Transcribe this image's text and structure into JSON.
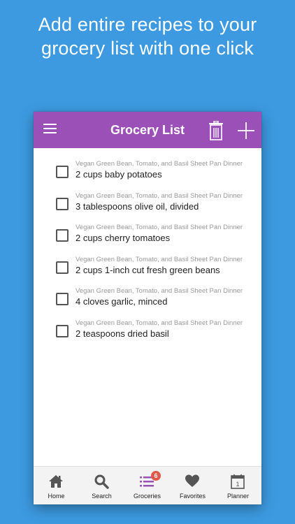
{
  "headline": {
    "line1": "Add entire recipes to your",
    "line2": "grocery list with one click"
  },
  "appbar": {
    "title": "Grocery List",
    "menu_icon": "hamburger-menu-icon",
    "trash_icon": "trash-icon",
    "add_icon": "plus-icon",
    "color": "#9a50b6"
  },
  "grocery_items": [
    {
      "recipe": "Vegan Green Bean, Tomato, and Basil Sheet Pan Dinner",
      "ingredient": "2 cups baby potatoes",
      "checked": false
    },
    {
      "recipe": "Vegan Green Bean, Tomato, and Basil Sheet Pan Dinner",
      "ingredient": "3 tablespoons olive oil, divided",
      "checked": false
    },
    {
      "recipe": "Vegan Green Bean, Tomato, and Basil Sheet Pan Dinner",
      "ingredient": "2 cups cherry tomatoes",
      "checked": false
    },
    {
      "recipe": "Vegan Green Bean, Tomato, and Basil Sheet Pan Dinner",
      "ingredient": "2 cups 1-inch cut fresh green beans",
      "checked": false
    },
    {
      "recipe": "Vegan Green Bean, Tomato, and Basil Sheet Pan Dinner",
      "ingredient": "4 cloves garlic, minced",
      "checked": false
    },
    {
      "recipe": "Vegan Green Bean, Tomato, and Basil Sheet Pan Dinner",
      "ingredient": "2 teaspoons dried basil",
      "checked": false
    }
  ],
  "tabbar": {
    "tabs": [
      {
        "label": "Home",
        "icon": "home-icon",
        "active": false
      },
      {
        "label": "Search",
        "icon": "search-icon",
        "active": false
      },
      {
        "label": "Groceries",
        "icon": "list-icon",
        "active": true,
        "badge": "6"
      },
      {
        "label": "Favorites",
        "icon": "heart-icon",
        "active": false
      },
      {
        "label": "Planner",
        "icon": "calendar-icon",
        "active": false
      }
    ]
  },
  "colors": {
    "background": "#3d9ae0",
    "active_tab": "#9a50b6",
    "badge": "#e2584b"
  }
}
